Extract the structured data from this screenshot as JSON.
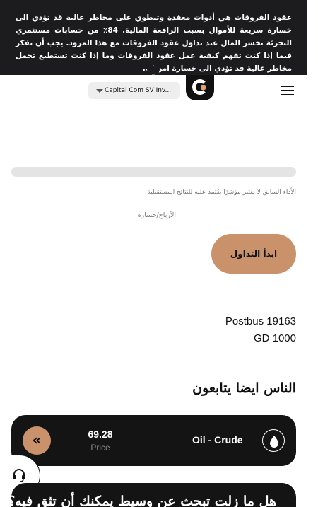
{
  "risk_warning": {
    "text": "عقود الفروقات هي أدوات معقدة وتنطوي على مخاطر عالية قد تؤدي الى خسارة سريعة للأموال بسبب الرافعة المالية. 84٪ من حسابات مستثمري التجزئة تخسر المال عند تداول عقود الفروقات مع هذا المزود. يجب أن تفكر فيما إذا كنت تفهم كيفية عمل عقود الفروقات وما إذا كنت تستطيع تحمل مخاطر عالية قد تؤدي الى خسارة اموالك.",
    "toggle_icon": "double-chevron-up-icon"
  },
  "header": {
    "account_select": "Capital Com SV Inv...",
    "logo_icon": "capital-com-logo",
    "menu_icon": "hamburger-menu-icon"
  },
  "main": {
    "disclaimer": "الأداء السابق لا يعتبر مؤشرًا يعُتمد عليه للنتائج المستقبلية",
    "profit_loss_label": "الأرباح/خسارة",
    "start_trading_button": "ابدأ التداول",
    "address": [
      "Postbus 19163",
      "GD 1000"
    ]
  },
  "people_also_follow": {
    "title": "الناس ايضا يتابعون",
    "instrument": {
      "name": "Oil - Crude",
      "price": "69.28",
      "price_label": "Price",
      "icon": "oil-drop-icon",
      "action_icon": "double-chevron-left-icon"
    }
  },
  "support": {
    "icon": "headset-icon"
  },
  "broker_card": {
    "title": "هل ما زلت تبحث عن وسيط يمكنك أن تثق فيه؟"
  },
  "colors": {
    "banner_bg": "#1c1c1e",
    "accent": "#c9926b",
    "card_bg": "#141414",
    "progress_track": "#e4e4e4"
  }
}
